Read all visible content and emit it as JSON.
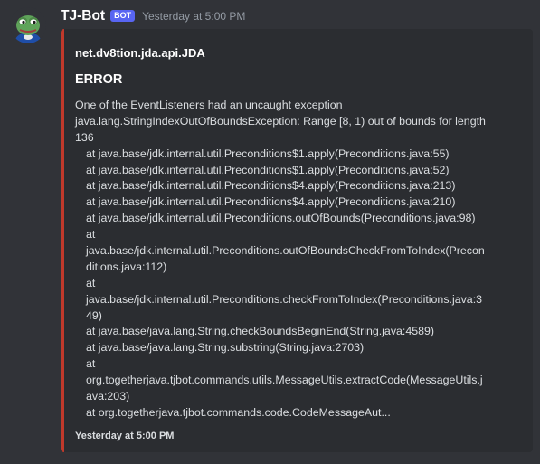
{
  "message": {
    "author": "TJ-Bot",
    "bot_tag": "BOT",
    "timestamp": "Yesterday at 5:00 PM"
  },
  "embed": {
    "accent_color": "#c0392b",
    "author": "net.dv8tion.jda.api.JDA",
    "title": "ERROR",
    "description_lines": [
      {
        "text": "One of the EventListeners had an uncaught exception",
        "indent": false
      },
      {
        "text": "java.lang.StringIndexOutOfBoundsException: Range [8, 1) out of bounds for length",
        "indent": false
      },
      {
        "text": "136",
        "indent": false
      },
      {
        "text": "at java.base/jdk.internal.util.Preconditions$1.apply(Preconditions.java:55)",
        "indent": true
      },
      {
        "text": "at java.base/jdk.internal.util.Preconditions$1.apply(Preconditions.java:52)",
        "indent": true
      },
      {
        "text": "at java.base/jdk.internal.util.Preconditions$4.apply(Preconditions.java:213)",
        "indent": true
      },
      {
        "text": "at java.base/jdk.internal.util.Preconditions$4.apply(Preconditions.java:210)",
        "indent": true
      },
      {
        "text": "at java.base/jdk.internal.util.Preconditions.outOfBounds(Preconditions.java:98)",
        "indent": true
      },
      {
        "text": "at",
        "indent": true
      },
      {
        "text": "java.base/jdk.internal.util.Preconditions.outOfBoundsCheckFromToIndex(Precon",
        "indent": true
      },
      {
        "text": "ditions.java:112)",
        "indent": true
      },
      {
        "text": "at",
        "indent": true
      },
      {
        "text": "java.base/jdk.internal.util.Preconditions.checkFromToIndex(Preconditions.java:3",
        "indent": true
      },
      {
        "text": "49)",
        "indent": true
      },
      {
        "text": "at java.base/java.lang.String.checkBoundsBeginEnd(String.java:4589)",
        "indent": true
      },
      {
        "text": "at java.base/java.lang.String.substring(String.java:2703)",
        "indent": true
      },
      {
        "text": "at",
        "indent": true
      },
      {
        "text": "org.togetherjava.tjbot.commands.utils.MessageUtils.extractCode(MessageUtils.j",
        "indent": true
      },
      {
        "text": "ava:203)",
        "indent": true
      },
      {
        "text": "at org.togetherjava.tjbot.commands.code.CodeMessageAut...",
        "indent": true
      }
    ],
    "footer": "Yesterday at 5:00 PM"
  },
  "icons": {
    "avatar": "frog-avatar-icon"
  }
}
